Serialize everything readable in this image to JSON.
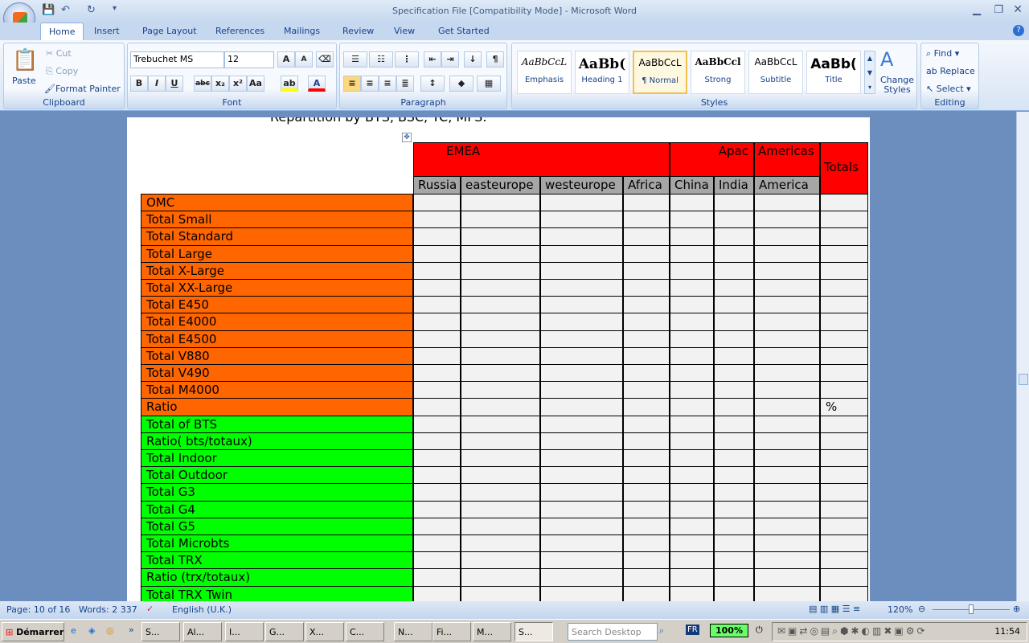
{
  "window": {
    "title": "Specification File [Compatibility Mode] - Microsoft Word"
  },
  "tabs": [
    "Home",
    "Insert",
    "Page Layout",
    "References",
    "Mailings",
    "Review",
    "View",
    "Get Started"
  ],
  "clipboard": {
    "label": "Clipboard",
    "paste": "Paste",
    "cut": "Cut",
    "copy": "Copy",
    "format_painter": "Format Painter"
  },
  "font": {
    "label": "Font",
    "name": "Trebuchet MS",
    "size": "12"
  },
  "paragraph": {
    "label": "Paragraph"
  },
  "styles": {
    "label": "Styles",
    "items": [
      {
        "preview": "AaBbCcL",
        "name": "Emphasis"
      },
      {
        "preview": "AaBb(",
        "name": "Heading 1"
      },
      {
        "preview": "AaBbCcL",
        "name": "¶ Normal"
      },
      {
        "preview": "AaBbCcl",
        "name": "Strong"
      },
      {
        "preview": "AaBbCcL",
        "name": "Subtitle"
      },
      {
        "preview": "AaBb(",
        "name": "Title"
      }
    ],
    "change": "Change Styles"
  },
  "editing": {
    "label": "Editing",
    "find": "Find",
    "replace": "Replace",
    "select": "Select"
  },
  "document": {
    "heading": "Repartition by BTS, BSC, TC, MFS:",
    "regions": [
      "EMEA",
      "Apac",
      "Americas",
      "Totals"
    ],
    "columns": [
      "Russia",
      "easteurope",
      "westeurope",
      "Africa",
      "China",
      "India",
      "America"
    ],
    "rows": [
      {
        "label": "OMC",
        "group": "orange"
      },
      {
        "label": "Total Small",
        "group": "orange"
      },
      {
        "label": "Total Standard",
        "group": "orange"
      },
      {
        "label": "Total Large",
        "group": "orange"
      },
      {
        "label": "Total X-Large",
        "group": "orange"
      },
      {
        "label": "Total XX-Large",
        "group": "orange"
      },
      {
        "label": "Total E450",
        "group": "orange"
      },
      {
        "label": "Total E4000",
        "group": "orange"
      },
      {
        "label": "Total E4500",
        "group": "orange"
      },
      {
        "label": "Total V880",
        "group": "orange"
      },
      {
        "label": "Total V490",
        "group": "orange"
      },
      {
        "label": "Total M4000",
        "group": "orange"
      },
      {
        "label": "Ratio",
        "group": "orange",
        "total": "%"
      },
      {
        "label": "Total of BTS",
        "group": "green"
      },
      {
        "label": "Ratio( bts/totaux)",
        "group": "green"
      },
      {
        "label": "Total Indoor",
        "group": "green"
      },
      {
        "label": "Total Outdoor",
        "group": "green"
      },
      {
        "label": "Total G3",
        "group": "green"
      },
      {
        "label": "Total G4",
        "group": "green"
      },
      {
        "label": "Total G5",
        "group": "green"
      },
      {
        "label": "Total Microbts",
        "group": "green"
      },
      {
        "label": "Total TRX",
        "group": "green"
      },
      {
        "label": "Ratio (trx/totaux)",
        "group": "green"
      },
      {
        "label": "Total TRX Twin",
        "group": "green"
      }
    ],
    "colors": {
      "orange": "#ff6600",
      "green": "#00ff00",
      "red": "#ff0000",
      "header_gray": "#a6a6a6",
      "cell": "#f2f2f2"
    }
  },
  "status": {
    "page": "Page: 10 of 16",
    "words": "Words: 2 337",
    "language": "English (U.K.)",
    "zoom": "120%"
  },
  "taskbar": {
    "start": "Démarrer",
    "items": [
      "S...",
      "Al...",
      "I...",
      "G...",
      "X...",
      "C...",
      "N...",
      "Fi...",
      "M...",
      "S..."
    ],
    "search_placeholder": "Search Desktop",
    "lang": "FR",
    "battery": "100%",
    "clock": "11:54"
  }
}
